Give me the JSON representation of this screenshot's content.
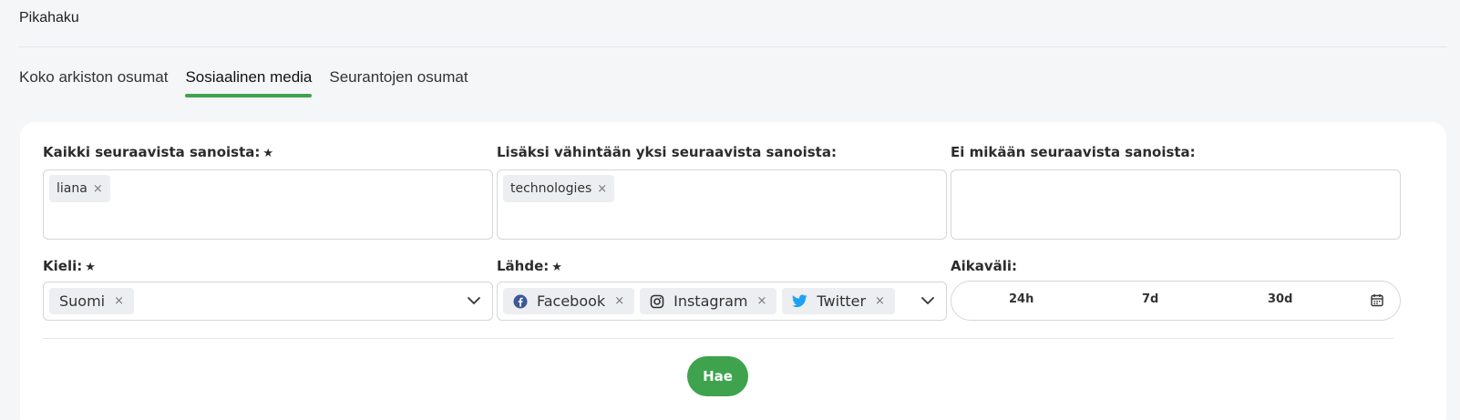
{
  "page": {
    "title": "Pikahaku"
  },
  "tabs": [
    {
      "label": "Koko arkiston osumat"
    },
    {
      "label": "Sosiaalinen media"
    },
    {
      "label": "Seurantojen osumat"
    }
  ],
  "form": {
    "all_words": {
      "label": "Kaikki seuraavista sanoista:",
      "required_mark": "★",
      "tags": [
        "liana"
      ]
    },
    "any_words": {
      "label": "Lisäksi vähintään yksi seuraavista sanoista:",
      "tags": [
        "technologies"
      ]
    },
    "none_words": {
      "label": "Ei mikään seuraavista sanoista:",
      "tags": []
    },
    "language": {
      "label": "Kieli:",
      "required_mark": "★",
      "selected": [
        "Suomi"
      ]
    },
    "source": {
      "label": "Lähde:",
      "required_mark": "★",
      "selected": [
        {
          "label": "Facebook",
          "icon": "facebook-icon",
          "color": "#3b5998"
        },
        {
          "label": "Instagram",
          "icon": "instagram-icon",
          "color": "#333333"
        },
        {
          "label": "Twitter",
          "icon": "twitter-icon",
          "color": "#1da1f2"
        }
      ]
    },
    "time_range": {
      "label": "Aikaväli:",
      "options": [
        "24h",
        "7d",
        "30d"
      ],
      "icon": "calendar-icon"
    },
    "remove_symbol": "×"
  },
  "actions": {
    "search_label": "Hae"
  },
  "colors": {
    "accent": "#3fa34d",
    "background": "#f5f6f8"
  }
}
